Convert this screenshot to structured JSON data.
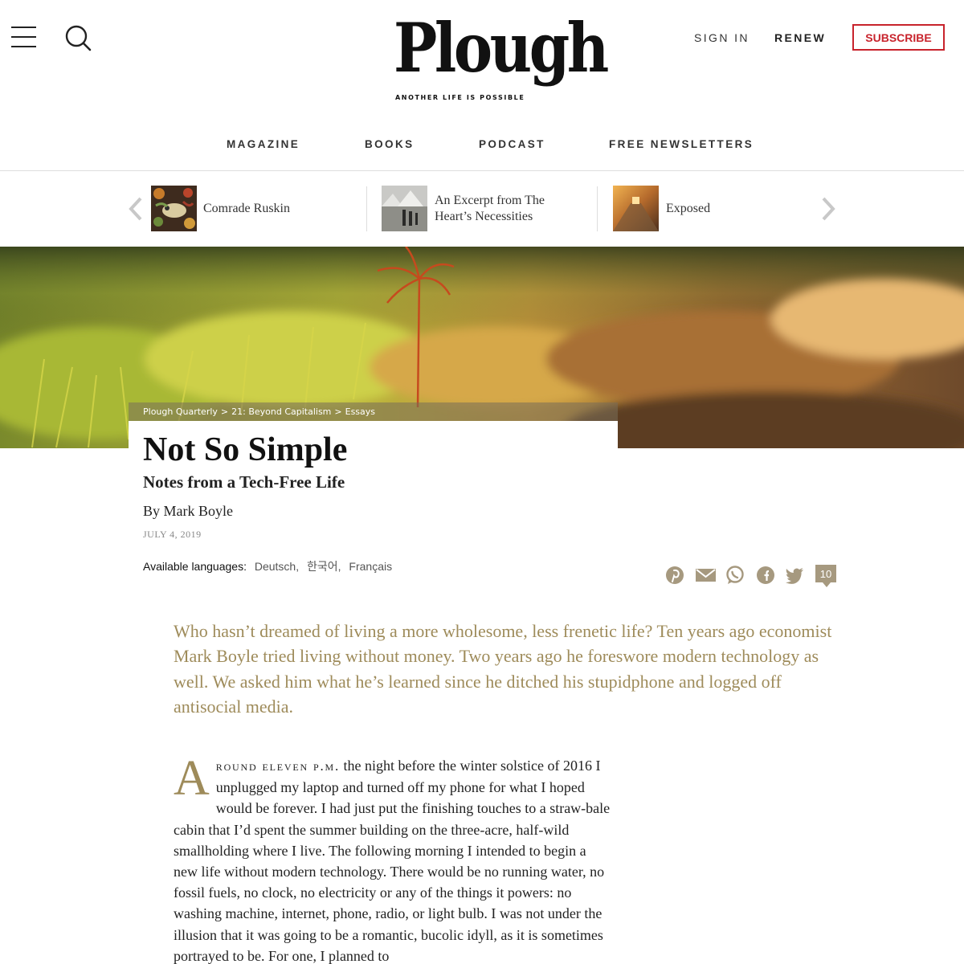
{
  "header": {
    "menu_icon": "hamburger-menu-icon",
    "search_icon": "magnifier-search-icon",
    "logo_text": "Plough",
    "logo_tagline": "ANOTHER LIFE IS POSSIBLE",
    "sign_in": "SIGN IN",
    "renew": "RENEW",
    "subscribe": "SUBSCRIBE",
    "subscribe_color": "#c8232c"
  },
  "nav": {
    "items": [
      "MAGAZINE",
      "BOOKS",
      "PODCAST",
      "FREE NEWSLETTERS"
    ]
  },
  "related": {
    "prev_icon": "chevron-left-icon",
    "next_icon": "chevron-right-icon",
    "items": [
      {
        "title": "Comrade Ruskin"
      },
      {
        "title": "An Excerpt from The Heart’s Necessities"
      },
      {
        "title": "Exposed"
      }
    ]
  },
  "breadcrumb": [
    "Plough Quarterly",
    "21: Beyond Capitalism",
    "Essays"
  ],
  "breadcrumb_separator": ">",
  "article": {
    "title": "Not So Simple",
    "subtitle": "Notes from a Tech-Free Life",
    "byline_prefix": "By",
    "author": "Mark Boyle",
    "date": "JULY 4, 2019",
    "languages_label": "Available languages:",
    "languages": [
      "Deutsch",
      "한국어",
      "Français"
    ],
    "share_icons": [
      "pinterest-icon",
      "email-icon",
      "whatsapp-icon",
      "facebook-icon",
      "twitter-icon"
    ],
    "comment_count": "10",
    "dek": "Who hasn’t dreamed of living a more wholesome, less frenetic life? Ten years ago economist Mark Boyle tried living without money. Two years ago he foreswore modern technology as well. We asked him what he’s learned since he ditched his stupidphone and logged off antisocial media.",
    "accent_color": "#9e8b5a",
    "body_dropcap": "A",
    "body_smallcaps": "round eleven p.m.",
    "body_text": " the night before the winter solstice of 2016 I unplugged my laptop and turned off my phone for what I hoped would be forever. I had just put the finishing touches to a straw-bale cabin that I’d spent the summer building on the three-acre, half-wild smallholding where I live. The following morning I intended to begin a new life without modern technology. There would be no running water, no fossil fuels, no clock, no electricity or any of the things it powers: no washing machine, internet, phone, radio, or light bulb. I was not under the illusion that it was going to be a romantic, bucolic idyll, as it is sometimes portrayed to be. For one, I planned to"
  }
}
